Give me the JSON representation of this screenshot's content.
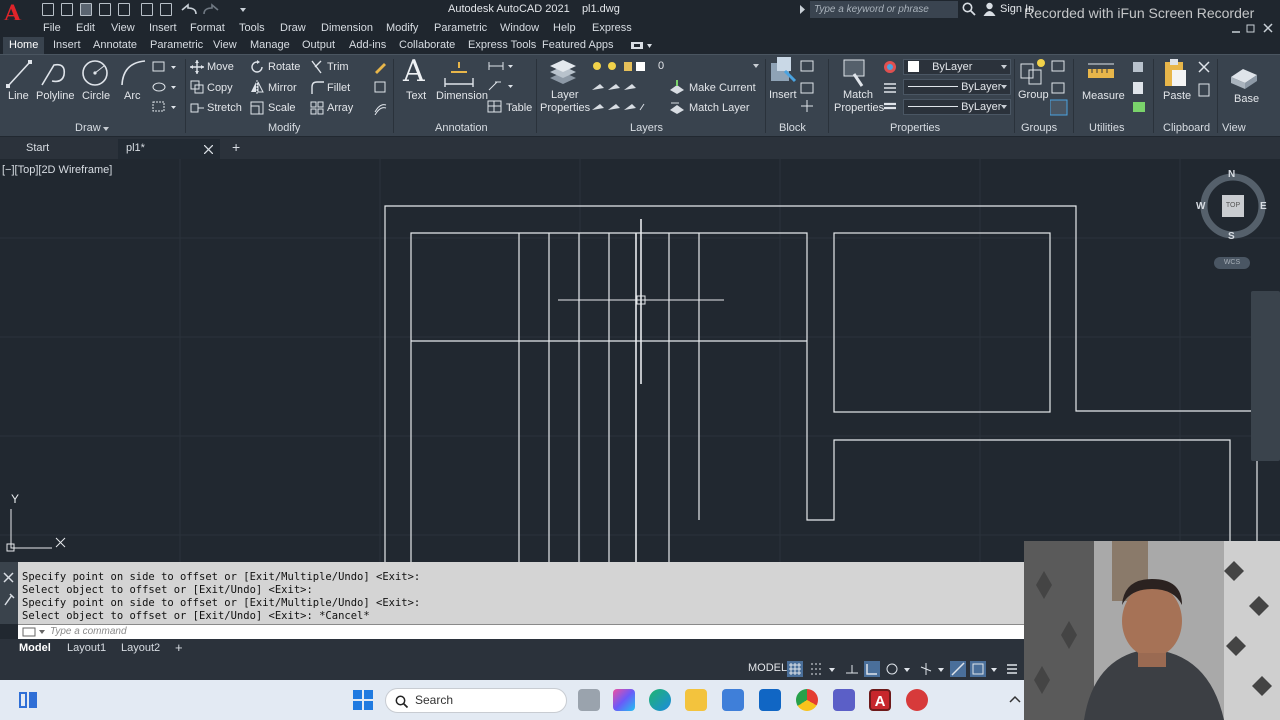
{
  "app": {
    "title": "Autodesk AutoCAD 2021",
    "filename": "pl1.dwg",
    "logo_letter": "A",
    "search_placeholder": "Type a keyword or phrase",
    "signin": "Sign In",
    "watermark": "Recorded with iFun Screen Recorder"
  },
  "menubar": [
    "File",
    "Edit",
    "View",
    "Insert",
    "Format",
    "Tools",
    "Draw",
    "Dimension",
    "Modify",
    "Parametric",
    "Window",
    "Help",
    "Express"
  ],
  "ribbon_tabs": [
    "Home",
    "Insert",
    "Annotate",
    "Parametric",
    "View",
    "Manage",
    "Output",
    "Add-ins",
    "Collaborate",
    "Express Tools",
    "Featured Apps"
  ],
  "ribbon_active_tab": "Home",
  "ribbon": {
    "draw": {
      "title": "Draw",
      "line": "Line",
      "polyline": "Polyline",
      "circle": "Circle",
      "arc": "Arc"
    },
    "modify": {
      "title": "Modify",
      "move": "Move",
      "rotate": "Rotate",
      "trim": "Trim",
      "copy": "Copy",
      "mirror": "Mirror",
      "fillet": "Fillet",
      "stretch": "Stretch",
      "scale": "Scale",
      "array": "Array"
    },
    "annotation": {
      "title": "Annotation",
      "text": "Text",
      "dimension": "Dimension",
      "table": "Table"
    },
    "layers": {
      "title": "Layers",
      "layer_properties_1": "Layer",
      "layer_properties_2": "Properties",
      "current_layer": "0",
      "make_current": "Make Current",
      "match_layer": "Match Layer"
    },
    "block": {
      "title": "Block",
      "insert": "Insert"
    },
    "properties": {
      "title": "Properties",
      "match_1": "Match",
      "match_2": "Properties",
      "color": "ByLayer",
      "linetype": "ByLayer",
      "lineweight": "ByLayer"
    },
    "groups": {
      "title": "Groups",
      "group": "Group"
    },
    "utilities": {
      "title": "Utilities",
      "measure": "Measure"
    },
    "clipboard": {
      "title": "Clipboard",
      "paste": "Paste"
    },
    "view": {
      "title": "View",
      "base": "Base"
    }
  },
  "file_tabs": {
    "start": "Start",
    "active": "pl1*",
    "add": "+"
  },
  "viewport_label": "[−][Top][2D Wireframe]",
  "viewcube": {
    "n": "N",
    "s": "S",
    "e": "E",
    "w": "W",
    "top": "TOP",
    "wcs": "WCS"
  },
  "ucs": {
    "y": "Y"
  },
  "command_history": [
    "Specify point on side to offset or [Exit/Multiple/Undo] <Exit>:",
    "Select object to offset or [Exit/Undo] <Exit>:",
    "Specify point on side to offset or [Exit/Multiple/Undo] <Exit>:",
    "Select object to offset or [Exit/Undo] <Exit>: *Cancel*"
  ],
  "command_placeholder": "Type a command",
  "layout_tabs": [
    "Model",
    "Layout1",
    "Layout2"
  ],
  "layout_add": "+",
  "status": {
    "model": "MODEL"
  },
  "taskbar": {
    "search": "Search"
  }
}
